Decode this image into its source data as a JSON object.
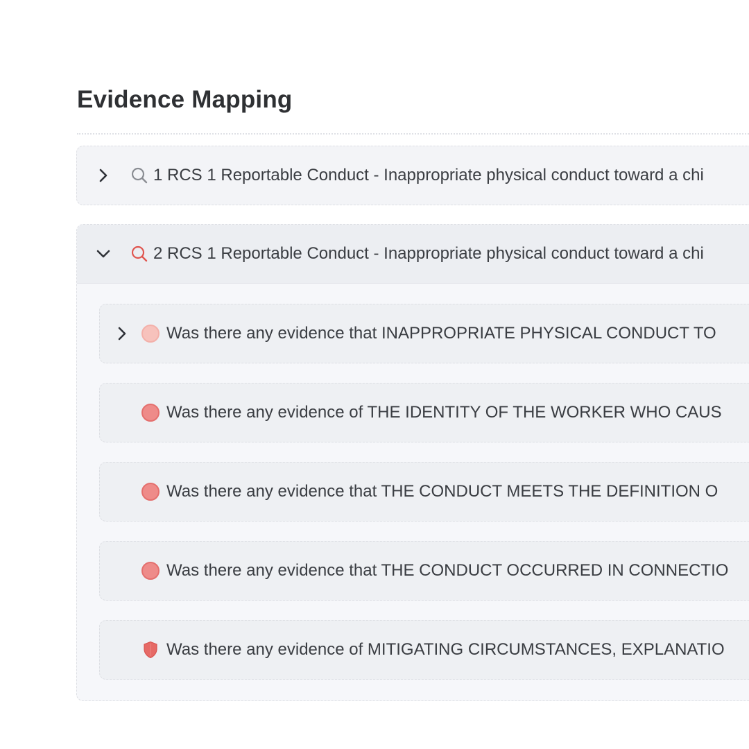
{
  "section": {
    "title": "Evidence Mapping"
  },
  "items": [
    {
      "label": "1 RCS 1 Reportable Conduct - Inappropriate physical conduct toward a chi",
      "state": "collapsed",
      "icon": "search-icon",
      "icon_color": "#8a8d93"
    },
    {
      "label": "2 RCS 1 Reportable Conduct - Inappropriate physical conduct toward a chi",
      "state": "expanded",
      "icon": "search-icon",
      "icon_color": "#e0554f",
      "children": [
        {
          "label": "Was there any evidence that INAPPROPRIATE PHYSICAL CONDUCT TO",
          "status": "faded-dot",
          "expandable": true
        },
        {
          "label": "Was there any evidence of THE IDENTITY OF THE WORKER WHO CAUS",
          "status": "dot",
          "expandable": false
        },
        {
          "label": "Was there any evidence that THE CONDUCT MEETS THE DEFINITION O",
          "status": "dot",
          "expandable": false
        },
        {
          "label": "Was there any evidence that THE CONDUCT OCCURRED IN CONNECTIO",
          "status": "dot",
          "expandable": false
        },
        {
          "label": "Was there any evidence of MITIGATING CIRCUMSTANCES, EXPLANATIO",
          "status": "shield",
          "expandable": false
        }
      ]
    }
  ],
  "colors": {
    "status_red": "#ee8b89",
    "status_faded": "#f7c2bc",
    "shield_red": "#e66a66"
  }
}
